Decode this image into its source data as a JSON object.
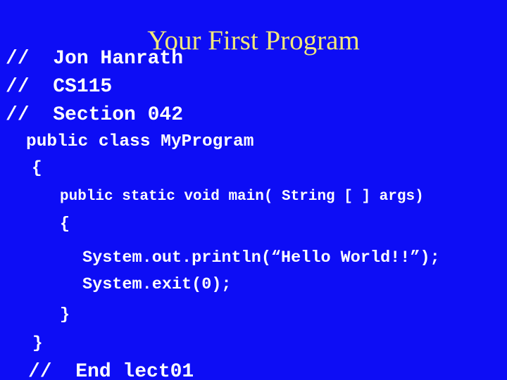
{
  "slide": {
    "title": "Your First Program",
    "background_color": "#0d0df5",
    "title_color": "#f2e87a",
    "code_color": "#ffffff"
  },
  "code": {
    "lines": [
      {
        "id": "comment-name",
        "text": "//  Jon Hanrath"
      },
      {
        "id": "comment-course",
        "text": "//  CS115"
      },
      {
        "id": "comment-sect",
        "text": "//  Section 042"
      },
      {
        "id": "class-decl",
        "text": "public class MyProgram"
      },
      {
        "id": "class-open",
        "text": "{"
      },
      {
        "id": "main-sig",
        "text": "public static void main( String [ ] args)"
      },
      {
        "id": "main-open",
        "text": "{"
      },
      {
        "id": "println",
        "text": "System.out.println(“Hello World!!”);"
      },
      {
        "id": "exit",
        "text": "System.exit(0);"
      },
      {
        "id": "main-close",
        "text": "}"
      },
      {
        "id": "class-close",
        "text": "}"
      },
      {
        "id": "end-comment",
        "text": "//  End lect01"
      }
    ]
  }
}
